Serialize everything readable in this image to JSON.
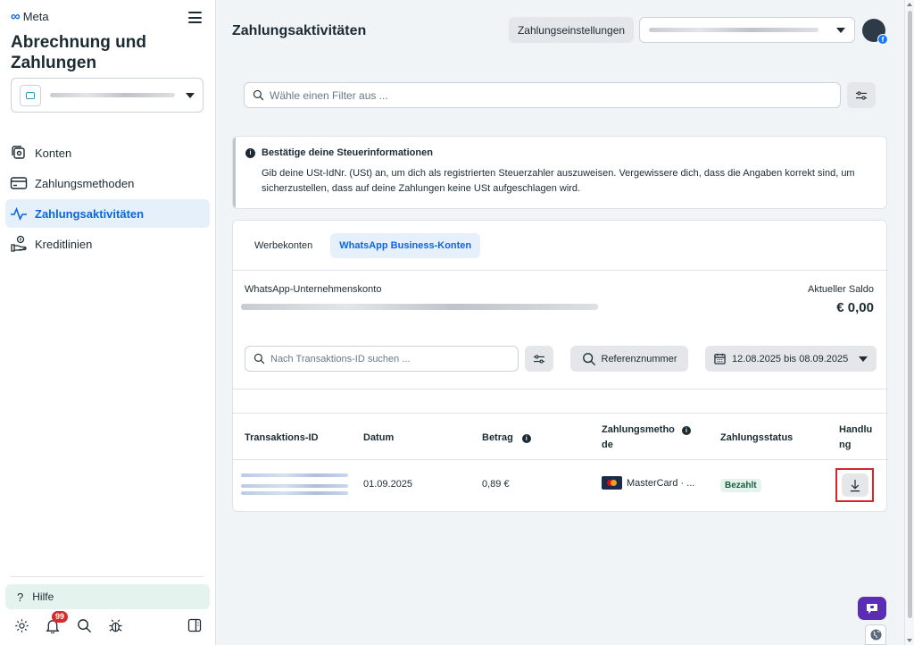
{
  "sidebar": {
    "brand": "Meta",
    "title": "Abrechnung und Zahlungen",
    "nav": [
      {
        "label": "Konten",
        "icon": "accounts-icon"
      },
      {
        "label": "Zahlungsmethoden",
        "icon": "credit-card-icon"
      },
      {
        "label": "Zahlungsaktivitäten",
        "icon": "activity-icon"
      },
      {
        "label": "Kreditlinien",
        "icon": "credit-line-icon"
      }
    ],
    "help_label": "Hilfe",
    "notifications_count": "99"
  },
  "header": {
    "title": "Zahlungsaktivitäten",
    "settings_button": "Zahlungseinstellungen"
  },
  "filter": {
    "placeholder": "Wähle einen Filter aus ..."
  },
  "notice": {
    "title": "Bestätige deine Steuerinformationen",
    "body": "Gib deine USt-IdNr. (USt) an, um dich als registrierten Steuerzahler auszuweisen. Vergewissere dich, dass die Angaben korrekt sind, um sicherzustellen, dass auf deine Zahlungen keine USt aufgeschlagen wird."
  },
  "tabs": [
    {
      "label": "Werbekonten",
      "active": false
    },
    {
      "label": "WhatsApp Business-Konten",
      "active": true
    }
  ],
  "account": {
    "label": "WhatsApp-Unternehmenskonto",
    "balance_label": "Aktueller Saldo",
    "balance_value": "€ 0,00"
  },
  "toolbar": {
    "search_placeholder": "Nach Transaktions-ID suchen ...",
    "reference_button": "Referenznummer",
    "date_range": "12.08.2025 bis 08.09.2025"
  },
  "table": {
    "headers": {
      "id": "Transaktions-ID",
      "date": "Datum",
      "amount": "Betrag",
      "method": "Zahlungsmetho de",
      "status": "Zahlungsstatus",
      "action": "Handlu ng"
    },
    "rows": [
      {
        "date": "01.09.2025",
        "amount": "0,89 €",
        "method": "MasterCard · ...",
        "status": "Bezahlt"
      }
    ]
  },
  "colors": {
    "accent": "#0a66e4",
    "highlight_border": "#d9262c",
    "chat_button": "#5b2db5"
  }
}
